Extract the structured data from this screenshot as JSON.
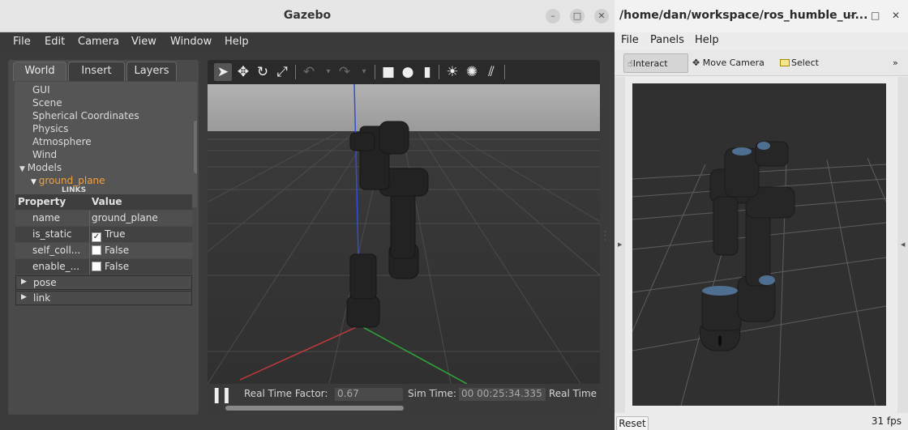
{
  "gazebo": {
    "title": "Gazebo",
    "window_buttons": {
      "minimize": "–",
      "maximize": "□",
      "close": "✕"
    },
    "menu": [
      "File",
      "Edit",
      "Camera",
      "View",
      "Window",
      "Help"
    ],
    "tabs": [
      "World",
      "Insert",
      "Layers"
    ],
    "tree": {
      "items": [
        "GUI",
        "Scene",
        "Spherical Coordinates",
        "Physics",
        "Atmosphere",
        "Wind"
      ],
      "models_label": "Models",
      "selected_model": "ground_plane",
      "links_label": "LINKS"
    },
    "properties": {
      "header": {
        "property": "Property",
        "value": "Value"
      },
      "rows": [
        {
          "key": "name",
          "value": "ground_plane",
          "checkbox": false
        },
        {
          "key": "is_static",
          "value": "True",
          "checkbox": true,
          "checked": true
        },
        {
          "key": "self_coll...",
          "value": "False",
          "checkbox": true,
          "checked": false
        },
        {
          "key": "enable_...",
          "value": "False",
          "checkbox": true,
          "checked": false
        }
      ],
      "groups": [
        "pose",
        "link"
      ]
    },
    "bottom": {
      "pause_icon": "pause-icon",
      "real_time_factor_label": "Real Time Factor:",
      "real_time_factor": "0.67",
      "sim_time_label": "Sim Time:",
      "sim_time": "00 00:25:34.335",
      "real_time_label": "Real Time"
    },
    "colors": {
      "selected": "#f2a13c",
      "toolbar": "#2a2a2a",
      "axis_z": "#2f4fd6",
      "axis_x": "#c63a3a",
      "axis_y": "#2fa83a"
    }
  },
  "rviz": {
    "title": "/home/dan/workspace/ros_humble_ur...",
    "window_buttons": {
      "minimize": "–",
      "maximize": "□",
      "close": "✕"
    },
    "menu": [
      "File",
      "Panels",
      "Help"
    ],
    "tools": {
      "interact": "Interact",
      "move_camera": "Move Camera",
      "select": "Select",
      "more": "»"
    },
    "reset_label": "Reset",
    "fps": "31 fps",
    "colors": {
      "joint_cap": "#4f6f90",
      "view_bg": "#303030"
    }
  }
}
